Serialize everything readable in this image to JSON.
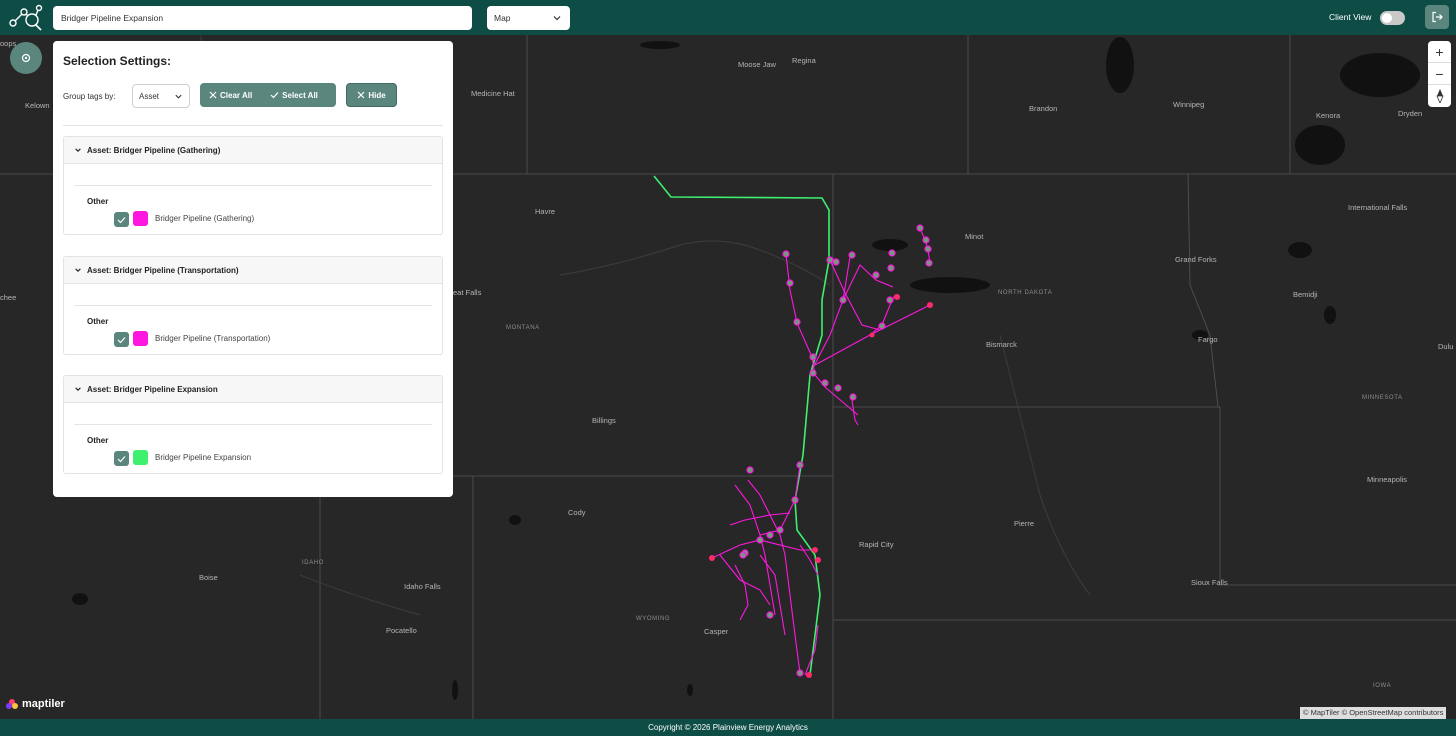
{
  "header": {
    "search_value": "Bridger Pipeline Expansion",
    "view_select": "Map",
    "client_view_label": "Client View",
    "client_view_on": false
  },
  "panel": {
    "title": "Selection Settings:",
    "group_tags_label": "Group tags by:",
    "group_tags_value": "Asset",
    "clear_all_label": "Clear All",
    "select_all_label": "Select All",
    "hide_label": "Hide",
    "sections": [
      {
        "title": "Asset: Bridger Pipeline (Gathering)",
        "group": "Other",
        "item": "Bridger Pipeline (Gathering)",
        "checked": true,
        "color": "#ff17e0"
      },
      {
        "title": "Asset: Bridger Pipeline (Transportation)",
        "group": "Other",
        "item": "Bridger Pipeline (Transportation)",
        "checked": true,
        "color": "#ff17e0"
      },
      {
        "title": "Asset: Bridger Pipeline Expansion",
        "group": "Other",
        "item": "Bridger Pipeline Expansion",
        "checked": true,
        "color": "#3df06e"
      }
    ]
  },
  "map": {
    "labels": {
      "moose_jaw": "Moose Jaw",
      "regina": "Regina",
      "medicine_hat": "Medicine Hat",
      "brandon": "Brandon",
      "winnipeg": "Winnipeg",
      "kenora": "Kenora",
      "dryden": "Dryden",
      "international_falls": "International Falls",
      "havre": "Havre",
      "minot": "Minot",
      "grand_forks": "Grand Forks",
      "bemidji": "Bemidji",
      "north_dakota": "NORTH DAKOTA",
      "great_falls": "eat Falls",
      "montana": "MONTANA",
      "bismarck": "Bismarck",
      "fargo": "Fargo",
      "minnesota": "MINNESOTA",
      "duluth": "Dulu",
      "billings": "Billings",
      "cody": "Cody",
      "rapid_city": "Rapid City",
      "pierre": "Pierre",
      "minneapolis": "Minneapolis",
      "boise": "Boise",
      "idaho": "IDAHO",
      "idaho_falls": "Idaho Falls",
      "sioux_falls": "Sioux Falls",
      "wyoming": "WYOMING",
      "casper": "Casper",
      "pocatello": "Pocatello",
      "iowa": "IOWA",
      "kelowna": "Kelown",
      "oops": "oops",
      "chee": "chee"
    },
    "attribution": "© MapTiler © OpenStreetMap contributors",
    "brand": "maptiler",
    "zoom_in": "+",
    "zoom_out": "−",
    "colors": {
      "gathering": "#ff17e0",
      "expansion": "#3df06e",
      "node": "#6f9a7c"
    }
  },
  "footer": {
    "copyright": "Copyright © 2026 Plainview Energy Analytics"
  }
}
